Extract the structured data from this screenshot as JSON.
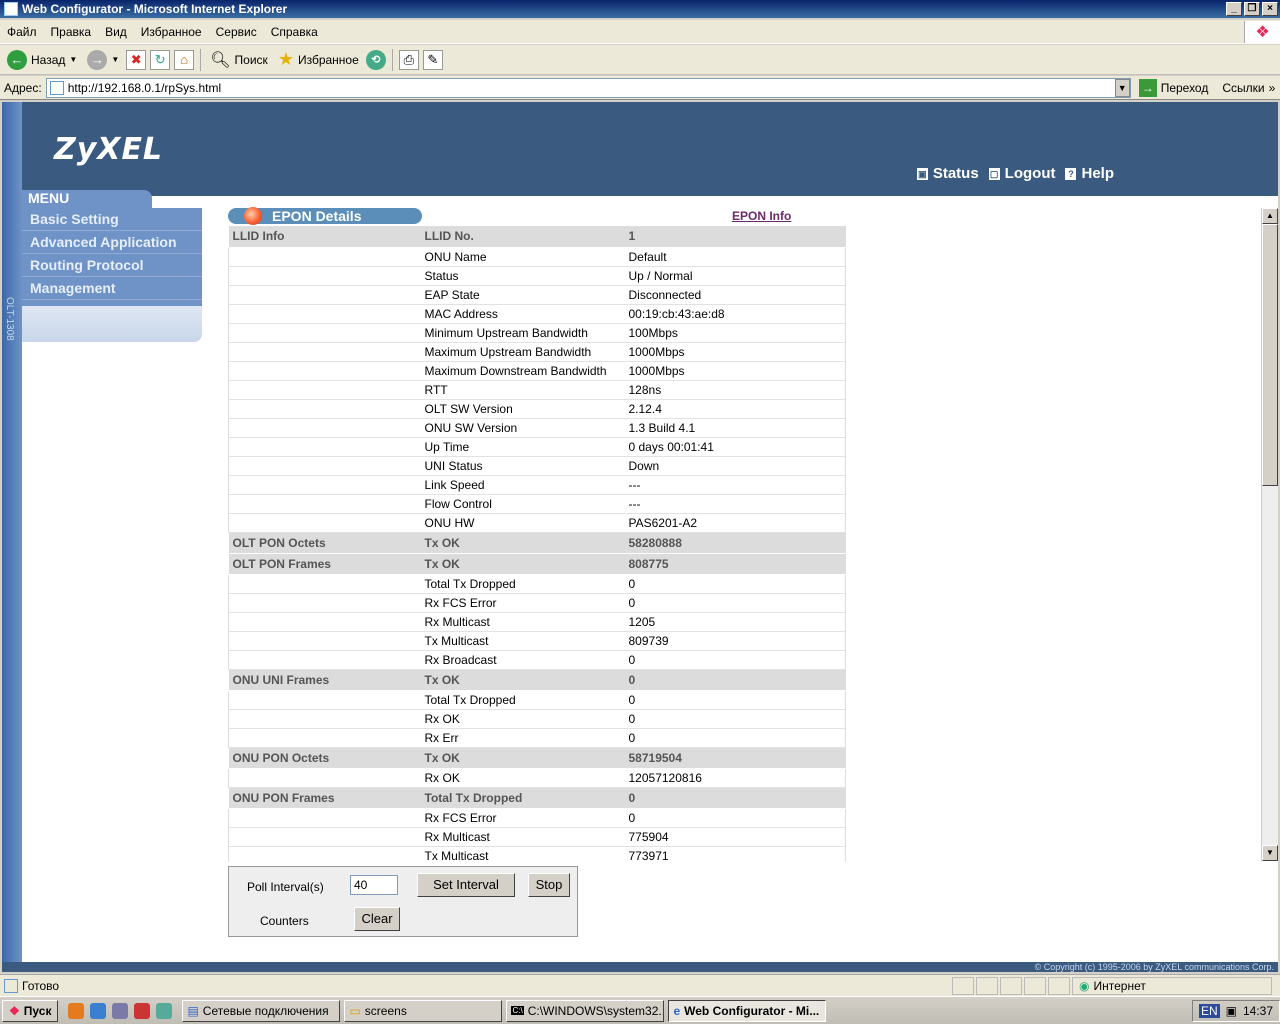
{
  "window": {
    "title": "Web Configurator - Microsoft Internet Explorer"
  },
  "menubar": [
    "Файл",
    "Правка",
    "Вид",
    "Избранное",
    "Сервис",
    "Справка"
  ],
  "toolbar": {
    "back": "Назад",
    "search": "Поиск",
    "favorites": "Избранное"
  },
  "address": {
    "label": "Адрес:",
    "url": "http://192.168.0.1/rpSys.html",
    "go": "Переход",
    "links": "Ссылки"
  },
  "brand": {
    "logo": "ZyXEL",
    "side_text": "OLT-1308"
  },
  "toplinks": {
    "status": "Status",
    "logout": "Logout",
    "help": "Help"
  },
  "menu": {
    "title": "MENU",
    "items": [
      "Basic Setting",
      "Advanced Application",
      "Routing Protocol",
      "Management"
    ]
  },
  "section": {
    "title": "EPON Details",
    "link": "EPON Info"
  },
  "table": [
    {
      "g": "LLID Info",
      "k": "LLID No.",
      "v": "1",
      "grp": true
    },
    {
      "g": "",
      "k": "ONU Name",
      "v": "Default"
    },
    {
      "g": "",
      "k": "Status",
      "v": "Up / Normal"
    },
    {
      "g": "",
      "k": "EAP State",
      "v": "Disconnected"
    },
    {
      "g": "",
      "k": "MAC Address",
      "v": "00:19:cb:43:ae:d8"
    },
    {
      "g": "",
      "k": "Minimum Upstream Bandwidth",
      "v": "100Mbps"
    },
    {
      "g": "",
      "k": "Maximum Upstream Bandwidth",
      "v": "1000Mbps"
    },
    {
      "g": "",
      "k": "Maximum Downstream Bandwidth",
      "v": "1000Mbps"
    },
    {
      "g": "",
      "k": "RTT",
      "v": "128ns"
    },
    {
      "g": "",
      "k": "OLT SW Version",
      "v": "2.12.4"
    },
    {
      "g": "",
      "k": "ONU SW Version",
      "v": "1.3 Build 4.1"
    },
    {
      "g": "",
      "k": "Up Time",
      "v": "0 days 00:01:41"
    },
    {
      "g": "",
      "k": "UNI Status",
      "v": "Down"
    },
    {
      "g": "",
      "k": "Link Speed",
      "v": "---"
    },
    {
      "g": "",
      "k": "Flow Control",
      "v": "---"
    },
    {
      "g": "",
      "k": "ONU HW",
      "v": "PAS6201-A2"
    },
    {
      "g": "OLT PON Octets",
      "k": "Tx OK",
      "v": "58280888",
      "grp": true
    },
    {
      "g": "OLT PON Frames",
      "k": "Tx OK",
      "v": "808775",
      "grp": true
    },
    {
      "g": "",
      "k": "Total Tx Dropped",
      "v": "0"
    },
    {
      "g": "",
      "k": "Rx FCS Error",
      "v": "0"
    },
    {
      "g": "",
      "k": "Rx Multicast",
      "v": "1205"
    },
    {
      "g": "",
      "k": "Tx Multicast",
      "v": "809739"
    },
    {
      "g": "",
      "k": "Rx Broadcast",
      "v": "0"
    },
    {
      "g": "ONU UNI Frames",
      "k": "Tx OK",
      "v": "0",
      "grp": true
    },
    {
      "g": "",
      "k": "Total Tx Dropped",
      "v": "0"
    },
    {
      "g": "",
      "k": "Rx OK",
      "v": "0"
    },
    {
      "g": "",
      "k": "Rx Err",
      "v": "0"
    },
    {
      "g": "ONU PON Octets",
      "k": "Tx OK",
      "v": "58719504",
      "grp": true
    },
    {
      "g": "",
      "k": "Rx OK",
      "v": "12057120816"
    },
    {
      "g": "ONU PON Frames",
      "k": "Total Tx Dropped",
      "v": "0",
      "grp": true
    },
    {
      "g": "",
      "k": "Rx FCS Error",
      "v": "0"
    },
    {
      "g": "",
      "k": "Rx Multicast",
      "v": "775904"
    },
    {
      "g": "",
      "k": "Tx Multicast",
      "v": "773971"
    }
  ],
  "poll": {
    "interval_label": "Poll Interval(s)",
    "interval_value": "40",
    "set_btn": "Set Interval",
    "stop_btn": "Stop",
    "counters_label": "Counters",
    "clear_btn": "Clear"
  },
  "copyright": "© Copyright (c) 1995-2006 by ZyXEL communications Corp.",
  "statusbar": {
    "text": "Готово",
    "zone": "Интернет"
  },
  "taskbar": {
    "start": "Пуск",
    "tasks": [
      "Сетевые подключения",
      "screens",
      "C:\\WINDOWS\\system32...",
      "Web Configurator - Mi..."
    ],
    "lang": "EN",
    "time": "14:37"
  }
}
